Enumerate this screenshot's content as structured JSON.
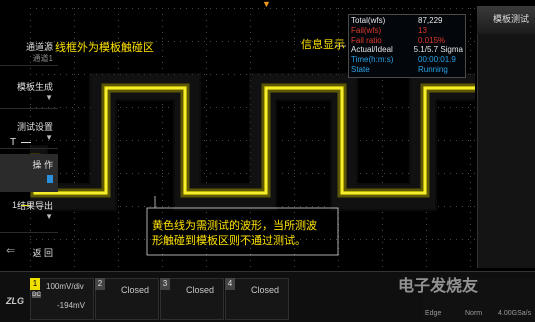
{
  "annotations": {
    "outside_frame": "线框外为模板触碰区",
    "info_display": "信息显示",
    "waveform_note_line1": "黄色线为需测试的波形，当所测波",
    "waveform_note_line2": "形触碰到模板区则不通过测试。"
  },
  "info_panel": {
    "rows": [
      {
        "label": "Total(wfs)",
        "value": "87,229",
        "color": "#e6e6e6"
      },
      {
        "label": "Fail(wfs)",
        "value": "13",
        "color": "#e0372b"
      },
      {
        "label": "Fail ratio",
        "value": "0.015%",
        "color": "#e0372b"
      },
      {
        "label": "Actual/Ideal",
        "value": "5.1/5.7 Sigma",
        "color": "#e6e6e6"
      },
      {
        "label": "Time(h:m:s)",
        "value": "00:00:01.9",
        "color": "#2aa3e6"
      },
      {
        "label": "State",
        "value": "Running",
        "color": "#2aa3e6"
      }
    ]
  },
  "markers": {
    "trigger": "T",
    "channel1": "1"
  },
  "side_menu": {
    "title": "模板测试",
    "items": [
      {
        "label": "通道源",
        "sub": "通道1",
        "arrow": ""
      },
      {
        "label": "模板生成",
        "sub": "",
        "arrow": "▼"
      },
      {
        "label": "测试设置",
        "sub": "",
        "arrow": "▼"
      },
      {
        "label": "操 作",
        "sub": "",
        "arrow": ""
      },
      {
        "label": "结果导出",
        "sub": "",
        "arrow": "▼"
      },
      {
        "label": "返 回",
        "sub": "",
        "arrow": ""
      }
    ]
  },
  "bottom_bar": {
    "logo": "ZLG",
    "ch1": {
      "num": "1",
      "scale": "100mV/div",
      "offset": "-194mV",
      "coupling_icon": "DC",
      "color": "#f0e000"
    },
    "ch2": {
      "num": "2",
      "state": "Closed"
    },
    "ch3": {
      "num": "3",
      "state": "Closed"
    },
    "ch4": {
      "num": "4",
      "state": "Closed"
    },
    "status": {
      "edge": "Edge",
      "norm": "Norm",
      "rate": "4.00GSa/s"
    }
  },
  "watermark": "电子发烧友",
  "colors": {
    "waveform": "#f2e800",
    "trigger_marker": "#f39a1b",
    "fail": "#e0372b",
    "info": "#2aa3e6"
  }
}
